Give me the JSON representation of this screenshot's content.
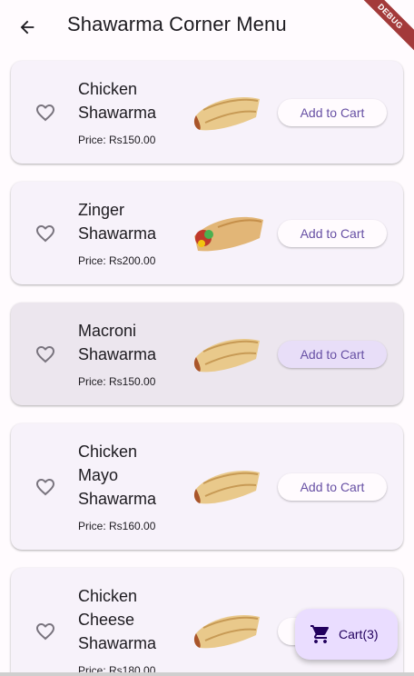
{
  "appbar": {
    "title": "Shawarma Corner Menu",
    "back_icon": "arrow-back-icon",
    "debug_banner": "DEBUG"
  },
  "colors": {
    "accent": "#6750a4",
    "card_bg": "#f7f2fa",
    "card_hover_bg": "#ece6ee",
    "fab_bg": "#eaddff",
    "debug_ribbon": "#a33a3a"
  },
  "menu": {
    "add_to_cart_label": "Add to Cart",
    "items": [
      {
        "name": "Chicken Shawarma",
        "price": "Price: Rs150.00",
        "favorite": false
      },
      {
        "name": "Zinger Shawarma",
        "price": "Price: Rs200.00",
        "favorite": false
      },
      {
        "name": "Macroni Shawarma",
        "price": "Price: Rs150.00",
        "favorite": false
      },
      {
        "name": "Chicken Mayo Shawarma",
        "price": "Price: Rs160.00",
        "favorite": false
      },
      {
        "name": "Chicken Cheese Shawarma",
        "price": "Price: Rs180.00",
        "favorite": false
      }
    ]
  },
  "fab": {
    "icon": "shopping-cart-icon",
    "label": "Cart(3)"
  }
}
